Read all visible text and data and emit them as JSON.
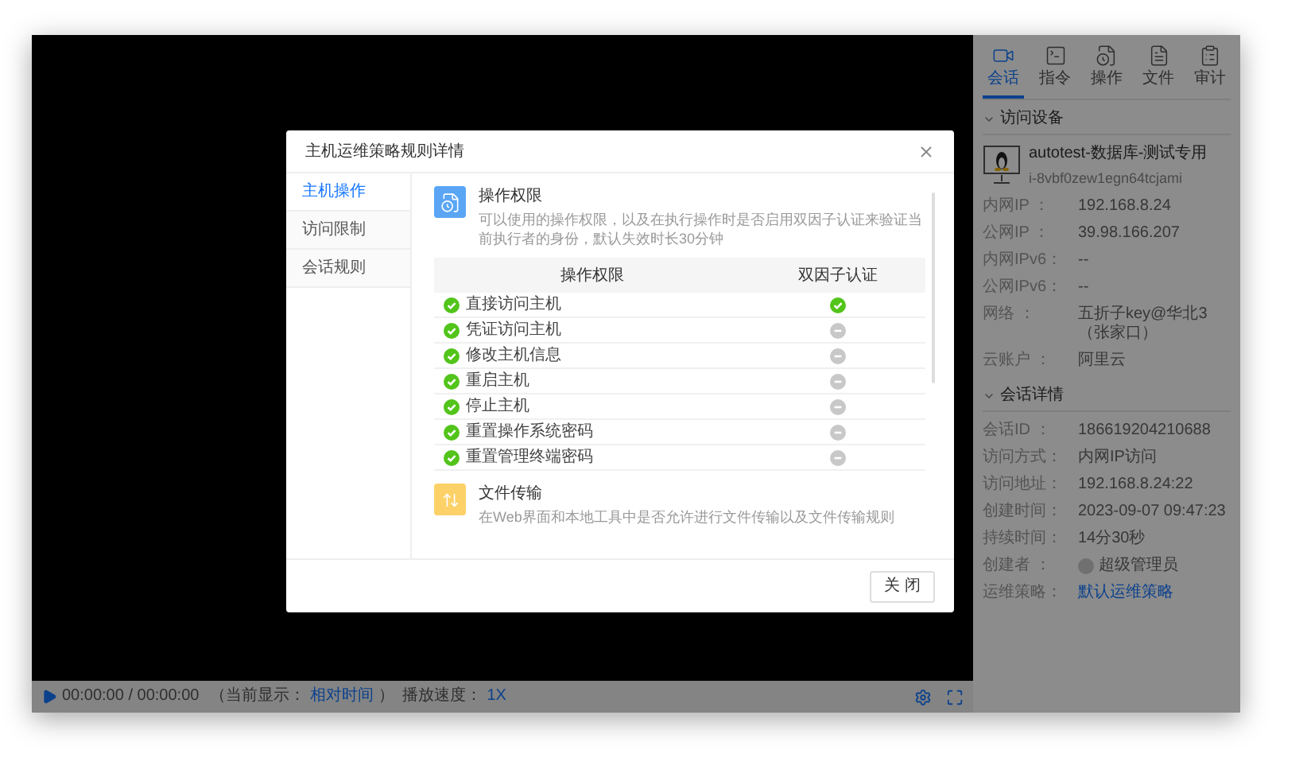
{
  "player": {
    "time": "00:00:00 / 00:00:00",
    "display_label": "（当前显示：",
    "display_value": "相对时间",
    "display_end": "）",
    "speed_label": "播放速度：",
    "speed_value": "1X"
  },
  "side_panel": {
    "tabs": [
      {
        "label": "会话",
        "selected": true
      },
      {
        "label": "指令",
        "selected": false
      },
      {
        "label": "操作",
        "selected": false
      },
      {
        "label": "文件",
        "selected": false
      },
      {
        "label": "审计",
        "selected": false
      }
    ],
    "device": {
      "title": "访问设备",
      "expanded": true,
      "name": "autotest-数据库-测试专用",
      "id": "i-8vbf0zew1egn64tcjami",
      "fields": [
        {
          "label": "内网IP ：",
          "value": "192.168.8.24"
        },
        {
          "label": "公网IP ：",
          "value": "39.98.166.207"
        },
        {
          "label": "内网IPv6：",
          "value": "--"
        },
        {
          "label": "公网IPv6：",
          "value": "--"
        },
        {
          "label": "网络 ：",
          "value": "五折子key@华北3（张家口）"
        },
        {
          "label": "云账户 ：",
          "value": "阿里云"
        }
      ]
    },
    "session": {
      "title": "会话详情",
      "expanded": true,
      "fields": [
        {
          "label": "会话ID ：",
          "value": "186619204210688",
          "kind": "text"
        },
        {
          "label": "访问方式：",
          "value": "内网IP访问",
          "kind": "text"
        },
        {
          "label": "访问地址：",
          "value": "192.168.8.24:22",
          "kind": "text"
        },
        {
          "label": "创建时间：",
          "value": "2023-09-07 09:47:23",
          "kind": "text"
        },
        {
          "label": "持续时间：",
          "value": "14分30秒",
          "kind": "text"
        },
        {
          "label": "创建者 ：",
          "value": "超级管理员",
          "kind": "user"
        },
        {
          "label": "运维策略：",
          "value": "默认运维策略",
          "kind": "link"
        }
      ]
    }
  },
  "modal": {
    "title": "主机运维策略规则详情",
    "nav": [
      {
        "label": "主机操作",
        "selected": true
      },
      {
        "label": "访问限制",
        "selected": false
      },
      {
        "label": "会话规则",
        "selected": false
      }
    ],
    "sections": [
      {
        "kind": "permissions",
        "title": "操作权限",
        "description": "可以使用的操作权限，以及在执行操作时是否启用双因子认证来验证当前执行者的身份，默认失效时长30分钟",
        "columns": [
          "操作权限",
          "双因子认证"
        ],
        "rows": [
          {
            "name": "直接访问主机",
            "allowed": true,
            "two_factor": true
          },
          {
            "name": "凭证访问主机",
            "allowed": true,
            "two_factor": false
          },
          {
            "name": "修改主机信息",
            "allowed": true,
            "two_factor": false
          },
          {
            "name": "重启主机",
            "allowed": true,
            "two_factor": false
          },
          {
            "name": "停止主机",
            "allowed": true,
            "two_factor": false
          },
          {
            "name": "重置操作系统密码",
            "allowed": true,
            "two_factor": false
          },
          {
            "name": "重置管理终端密码",
            "allowed": true,
            "two_factor": false
          }
        ]
      },
      {
        "kind": "file_transfer",
        "title": "文件传输",
        "description": "在Web界面和本地工具中是否允许进行文件传输以及文件传输规则"
      }
    ],
    "close_button": "关 闭"
  }
}
